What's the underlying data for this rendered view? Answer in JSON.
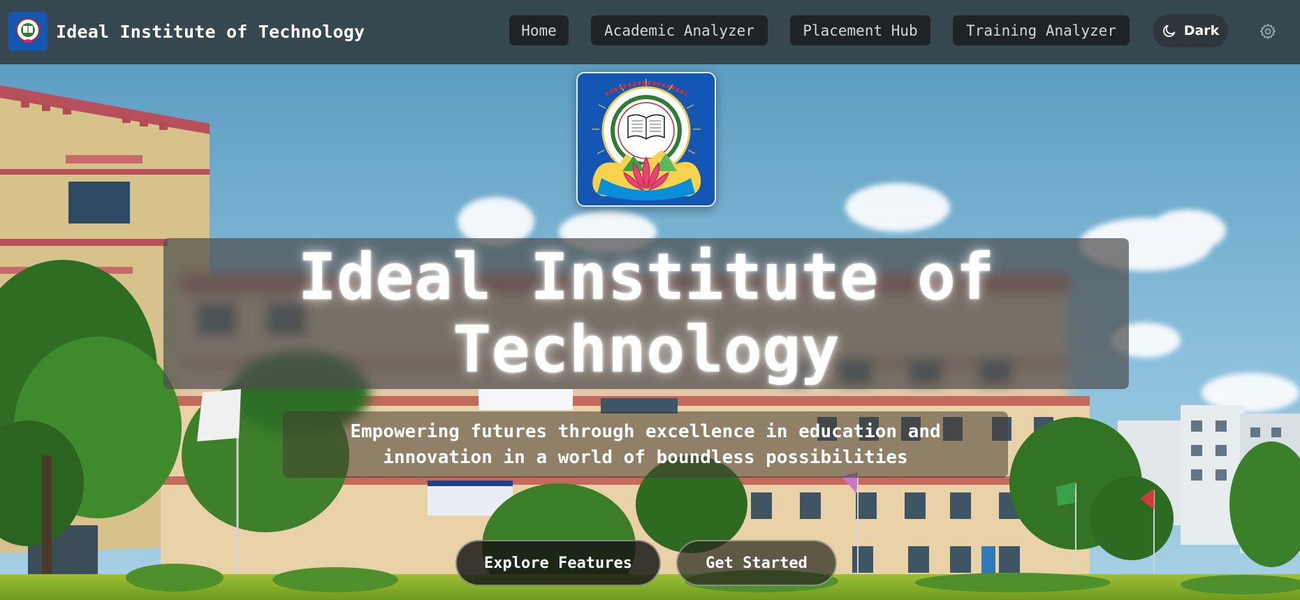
{
  "navbar": {
    "brand_name": "Ideal Institute of Technology",
    "links": [
      {
        "label": "Home"
      },
      {
        "label": "Academic Analyzer"
      },
      {
        "label": "Placement Hub"
      },
      {
        "label": "Training Analyzer"
      }
    ],
    "theme_toggle_label": "Dark",
    "icons": {
      "theme": "moon-icon",
      "settings": "gear-icon"
    }
  },
  "hero": {
    "title": "Ideal Institute of Technology",
    "subtitle": "Empowering futures through excellence in education and innovation in a world of boundless possibilities",
    "buttons": [
      {
        "label": "Explore Features"
      },
      {
        "label": "Get Started"
      }
    ]
  },
  "colors": {
    "navbar_bg": "#37474f",
    "nav_button_bg": "#1f2326",
    "logo_blue": "#1456b3"
  }
}
